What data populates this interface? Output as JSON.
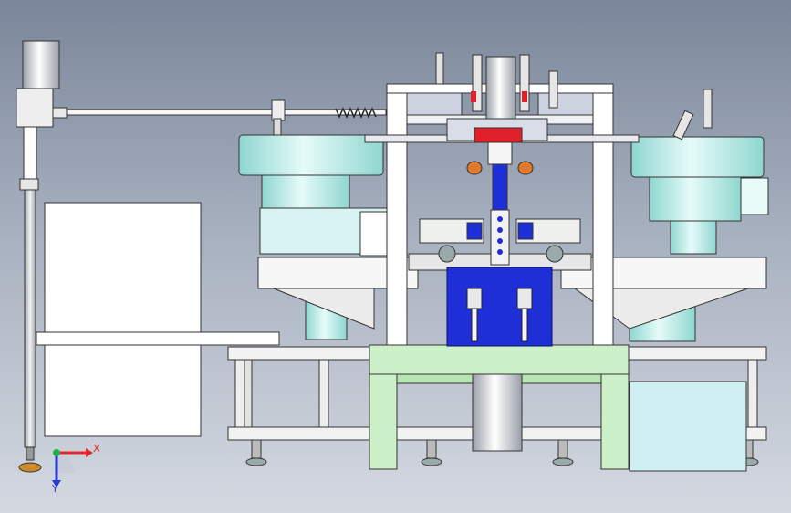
{
  "viewport": {
    "background_top": "#7a8699",
    "background_bottom": "#d4d9e1"
  },
  "colors": {
    "frame": "#f4f4f4",
    "bowl": "#c9f2ef",
    "bowl_dark": "#8fd6d0",
    "base_table": "#ccf0c8",
    "blue_block": "#1f2fd8",
    "cabinet": "#cfeff3",
    "accent_red": "#e0202a",
    "accent_orange": "#e07a2a"
  },
  "axis_triad": {
    "x_label": "X",
    "y_label": "Y",
    "x_color": "#e8262d",
    "y_color": "#2a3ad8",
    "origin_color": "#22b04a"
  }
}
